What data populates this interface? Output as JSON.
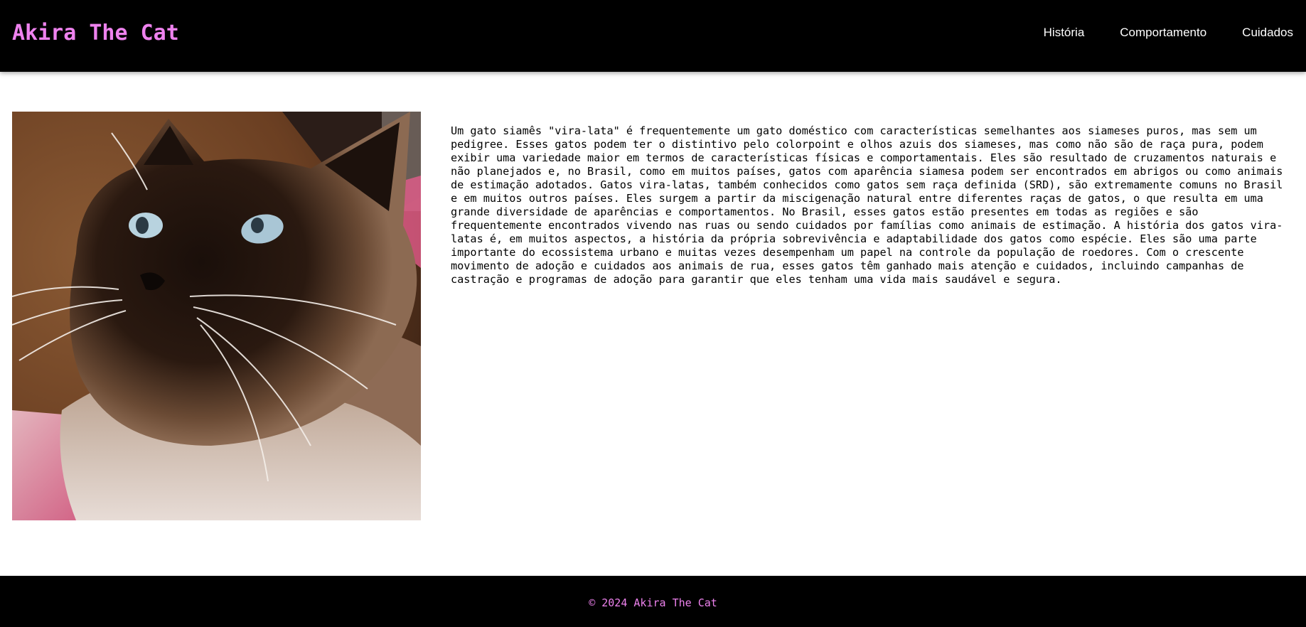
{
  "header": {
    "brand": "Akira The Cat",
    "nav": [
      {
        "label": "História"
      },
      {
        "label": "Comportamento"
      },
      {
        "label": "Cuidados"
      }
    ]
  },
  "main": {
    "image_icon": "cat-photo",
    "paragraph": "Um gato siamês \"vira-lata\" é frequentemente um gato doméstico com características semelhantes aos siameses puros, mas sem um pedigree. Esses gatos podem ter o distintivo pelo colorpoint e olhos azuis dos siameses, mas como não são de raça pura, podem exibir uma variedade maior em termos de características físicas e comportamentais. Eles são resultado de cruzamentos naturais e não planejados e, no Brasil, como em muitos países, gatos com aparência siamesa podem ser encontrados em abrigos ou como animais de estimação adotados. Gatos vira-latas, também conhecidos como gatos sem raça definida (SRD), são extremamente comuns no Brasil e em muitos outros países. Eles surgem a partir da miscigenação natural entre diferentes raças de gatos, o que resulta em uma grande diversidade de aparências e comportamentos. No Brasil, esses gatos estão presentes em todas as regiões e são frequentemente encontrados vivendo nas ruas ou sendo cuidados por famílias como animais de estimação. A história dos gatos vira-latas é, em muitos aspectos, a história da própria sobrevivência e adaptabilidade dos gatos como espécie. Eles são uma parte importante do ecossistema urbano e muitas vezes desempenham um papel na controle da população de roedores. Com o crescente movimento de adoção e cuidados aos animais de rua, esses gatos têm ganhado mais atenção e cuidados, incluindo campanhas de castração e programas de adoção para garantir que eles tenham uma vida mais saudável e segura."
  },
  "footer": {
    "copyright": "© 2024 Akira The Cat"
  },
  "colors": {
    "header_bg": "#000000",
    "brand": "#ee82ee",
    "nav_text": "#ffffff",
    "footer_text": "#ee82ee"
  }
}
